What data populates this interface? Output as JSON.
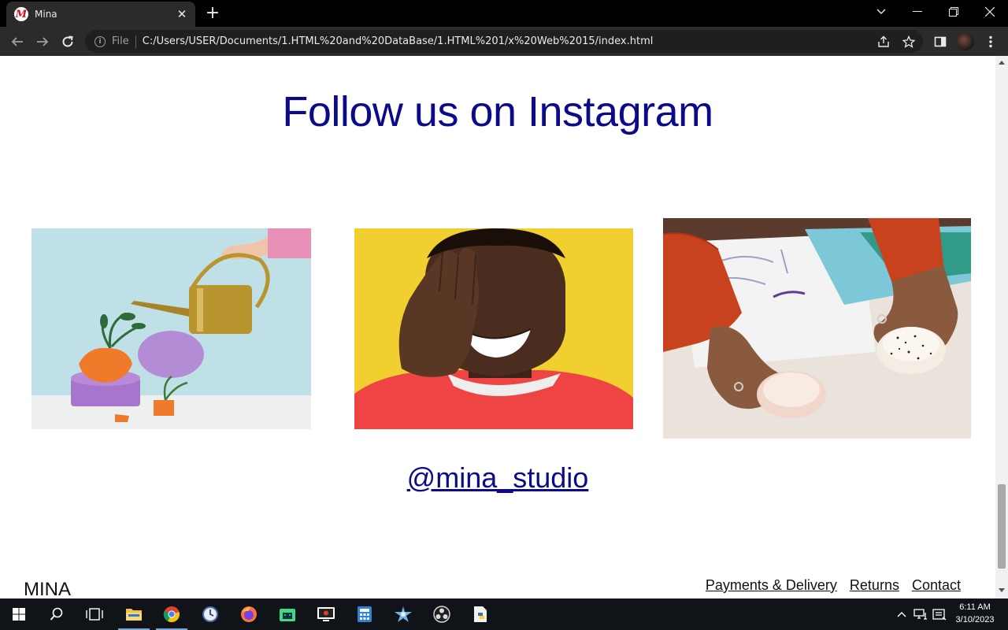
{
  "browser": {
    "tab_title": "Mina",
    "tab_favicon": "M",
    "scheme_label": "File",
    "url": "C:/Users/USER/Documents/1.HTML%20and%20DataBase/1.HTML%201/x%20Web%2015/index.html",
    "icons": [
      "back-icon",
      "forward-icon",
      "reload-icon",
      "info-icon",
      "share-icon",
      "bookmark-star-icon",
      "side-panel-icon",
      "profile-avatar",
      "menu-dots-icon",
      "tab-search-icon",
      "minimize-icon",
      "restore-icon",
      "close-icon"
    ]
  },
  "page": {
    "heading": "Follow us on Instagram",
    "instagram_handle": "@mina_studio",
    "images": [
      {
        "name": "watering-can-plants-photo",
        "colors": {
          "bg": "#bfe0e6",
          "floor": "#eef0ef",
          "accent": "#f07a2a",
          "purple": "#a776cc",
          "gold": "#b8952e"
        }
      },
      {
        "name": "smiling-man-photo",
        "colors": {
          "bg": "#f0cf2e",
          "sweater": "#ee4444",
          "skin": "#4a2d1f"
        }
      },
      {
        "name": "hands-with-bowls-photo",
        "colors": {
          "table": "#e9e3db",
          "sleeve": "#c9421e",
          "paper": "#f3f3f3",
          "teal": "#7cc7d8"
        }
      }
    ],
    "footer": {
      "brand": "MINA",
      "links": [
        "Payments & Delivery",
        "Returns",
        "Contact"
      ]
    },
    "colors": {
      "heading": "#0a0a8a",
      "link": "#0a0a8a",
      "background": "#ffffff"
    }
  },
  "taskbar": {
    "apps": [
      "windows-start-icon",
      "search-icon",
      "task-view-icon",
      "file-explorer-icon",
      "chrome-icon",
      "clock-app-icon",
      "firefox-icon",
      "android-studio-icon",
      "screen-recorder-icon",
      "calculator-icon",
      "bluetooth-app-icon",
      "obs-icon",
      "python-icon"
    ],
    "time": "6:11 AM",
    "date": "3/10/2023"
  }
}
